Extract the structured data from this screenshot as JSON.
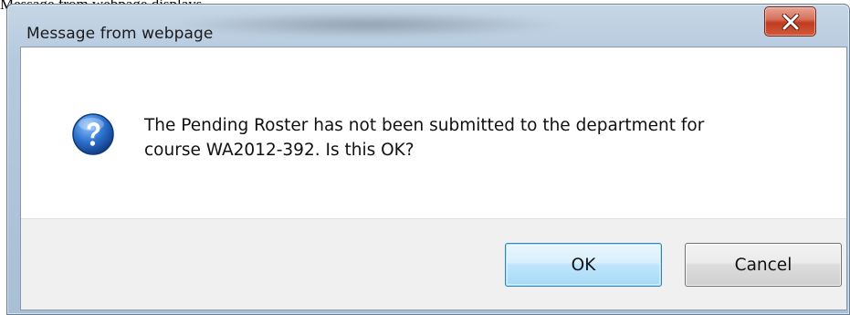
{
  "caption": "Message from webpage displays",
  "dialog": {
    "title": "Message from webpage",
    "close_icon": "close-icon",
    "message_icon": "question-icon",
    "message_lines": [
      "The Pending Roster has not been submitted to the department for",
      "course WA2012-392. Is this OK?"
    ],
    "ok_label": "OK",
    "cancel_label": "Cancel"
  },
  "colors": {
    "close_button": "#c13b1f",
    "ok_border": "#3c7fb1",
    "question_icon": "#1f5fb2"
  }
}
